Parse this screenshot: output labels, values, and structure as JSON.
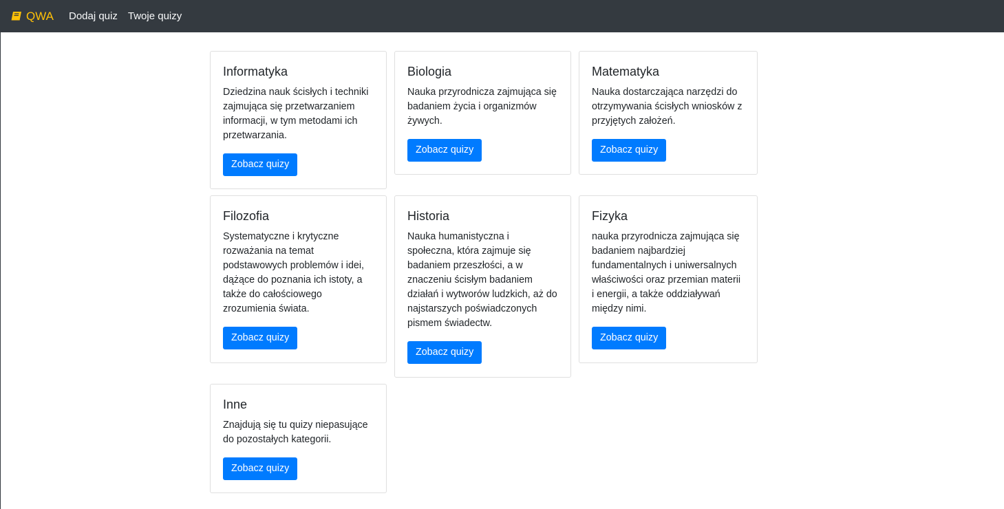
{
  "navbar": {
    "brand": "QWA",
    "links": [
      {
        "label": "Dodaj quiz"
      },
      {
        "label": "Twoje quizy"
      }
    ],
    "brand_color": "#ffc107",
    "background": "#343a40"
  },
  "categories": [
    {
      "title": "Informatyka",
      "description": "Dziedzina nauk ścisłych i techniki zajmująca się przetwarzaniem informacji, w tym metodami ich przetwarzania.",
      "button": "Zobacz quizy"
    },
    {
      "title": "Biologia",
      "description": "Nauka przyrodnicza zajmująca się badaniem życia i organizmów żywych.",
      "button": "Zobacz quizy"
    },
    {
      "title": "Matematyka",
      "description": "Nauka dostarczająca narzędzi do otrzymywania ścisłych wniosków z przyjętych założeń.",
      "button": "Zobacz quizy"
    },
    {
      "title": "Filozofia",
      "description": "Systematyczne i krytyczne rozważania na temat podstawowych problemów i idei, dążące do poznania ich istoty, a także do całościowego zrozumienia świata.",
      "button": "Zobacz quizy"
    },
    {
      "title": "Historia",
      "description": "Nauka humanistyczna i społeczna, która zajmuje się badaniem przeszłości, a w znaczeniu ścisłym badaniem działań i wytworów ludzkich, aż do najstarszych poświadczonych pismem świadectw.",
      "button": "Zobacz quizy"
    },
    {
      "title": "Fizyka",
      "description": "nauka przyrodnicza zajmująca się badaniem najbardziej fundamentalnych i uniwersalnych właściwości oraz przemian materii i energii, a także oddziaływań między nimi.",
      "button": "Zobacz quizy"
    },
    {
      "title": "Inne",
      "description": "Znajdują się tu quizy niepasujące do pozostałych kategorii.",
      "button": "Zobacz quizy"
    }
  ],
  "colors": {
    "primary_button": "#007bff"
  }
}
